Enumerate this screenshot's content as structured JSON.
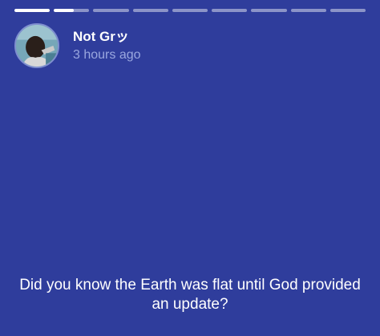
{
  "story": {
    "segments": [
      {
        "progress": 1
      },
      {
        "progress": 0.55
      },
      {
        "progress": 0
      },
      {
        "progress": 0
      },
      {
        "progress": 0
      },
      {
        "progress": 0
      },
      {
        "progress": 0
      },
      {
        "progress": 0
      },
      {
        "progress": 0
      }
    ],
    "author": {
      "name": "Not Grッ",
      "posted": "3 hours ago"
    },
    "caption": "Did you know the Earth was flat until God provided an update?"
  },
  "colors": {
    "background": "#2f3d9c",
    "timestamp": "#9aa7df",
    "text": "#ffffff"
  }
}
